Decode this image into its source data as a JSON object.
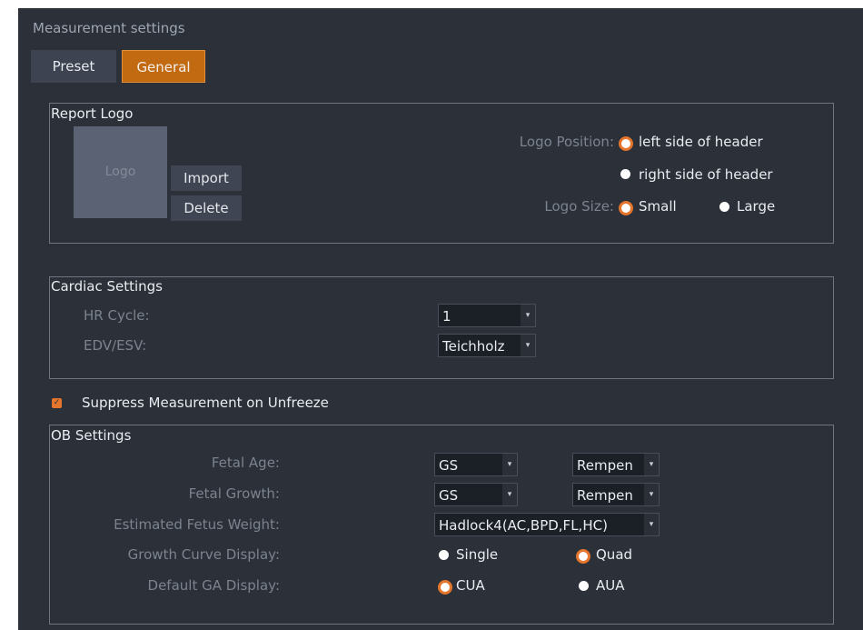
{
  "window": {
    "title": "Measurement settings"
  },
  "tabs": [
    {
      "label": "Preset",
      "active": false
    },
    {
      "label": "General",
      "active": true
    }
  ],
  "report_logo": {
    "legend": "Report Logo",
    "logo_placeholder": "Logo",
    "import_label": "Import",
    "delete_label": "Delete",
    "position_label": "Logo Position:",
    "position_options": [
      "left side of header",
      "right side of header"
    ],
    "position_selected": "left side of header",
    "size_label": "Logo Size:",
    "size_options": [
      "Small",
      "Large"
    ],
    "size_selected": "Small"
  },
  "cardiac": {
    "legend": "Cardiac Settings",
    "hr_cycle_label": "HR Cycle:",
    "hr_cycle_value": "1",
    "edv_esv_label": "EDV/ESV:",
    "edv_esv_value": "Teichholz"
  },
  "suppress": {
    "label": "Suppress Measurement on Unfreeze",
    "checked": true
  },
  "ob": {
    "legend": "OB Settings",
    "fetal_age_label": "Fetal Age:",
    "fetal_age_value": "GS",
    "fetal_age_author": "Rempen",
    "fetal_growth_label": "Fetal Growth:",
    "fetal_growth_value": "GS",
    "fetal_growth_author": "Rempen",
    "efw_label": "Estimated Fetus Weight:",
    "efw_value": "Hadlock4(AC,BPD,FL,HC)",
    "growth_curve_label": "Growth Curve Display:",
    "growth_curve_options": [
      "Single",
      "Quad"
    ],
    "growth_curve_selected": "Quad",
    "ga_display_label": "Default GA Display:",
    "ga_display_options": [
      "CUA",
      "AUA"
    ],
    "ga_display_selected": "CUA"
  },
  "colors": {
    "panel_bg": "#2b3039",
    "accent": "#e3752c",
    "active_tab": "#c26a12",
    "inactive_tab": "#3d4350"
  },
  "icons": {
    "dropdown": "▾",
    "check": "✓"
  }
}
